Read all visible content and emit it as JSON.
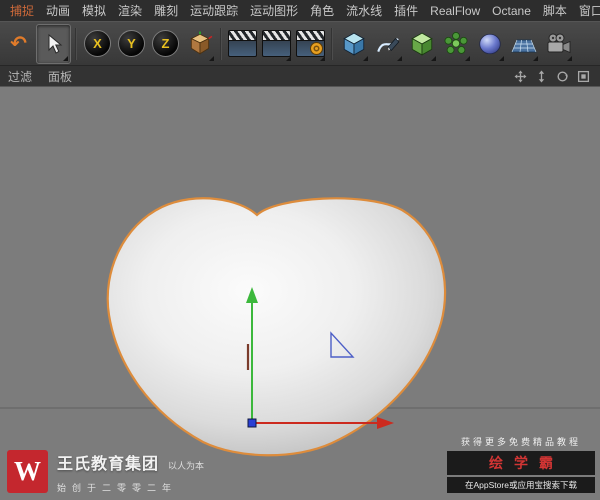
{
  "colors": {
    "menubar_bg": "#2d2d2d",
    "accent_menu": "#cf6a3a",
    "viewport_bg": "#7c7c7c",
    "heart_outline": "#dd8c3c",
    "axis_green": "#3cb83c",
    "axis_red": "#cc2a1e",
    "origin_blue": "#2a3fd4",
    "logo_red": "#c4272e",
    "brand_red": "#d23534",
    "xyz_yellow": "#e8c020"
  },
  "menubar": {
    "items": [
      {
        "label": "捕捉"
      },
      {
        "label": "动画"
      },
      {
        "label": "模拟"
      },
      {
        "label": "渲染"
      },
      {
        "label": "雕刻"
      },
      {
        "label": "运动跟踪"
      },
      {
        "label": "运动图形"
      },
      {
        "label": "角色"
      },
      {
        "label": "流水线"
      },
      {
        "label": "插件"
      },
      {
        "label": "RealFlow"
      },
      {
        "label": "Octane"
      },
      {
        "label": "脚本"
      },
      {
        "label": "窗口"
      }
    ]
  },
  "toolbar": {
    "axis_locks": {
      "x": "X",
      "y": "Y",
      "z": "Z"
    },
    "icons": [
      "undo-icon",
      "live-selection-icon",
      "lock-x-axis-icon",
      "lock-y-axis-icon",
      "lock-z-axis-icon",
      "coordinate-system-icon",
      "render-view-icon",
      "render-picture-viewer-icon",
      "render-settings-icon",
      "add-primitive-cube-icon",
      "spline-pen-icon",
      "subdivision-surface-icon",
      "array-generator-icon",
      "deformer-icon",
      "floor-grid-icon",
      "camera-icon"
    ]
  },
  "viewbar": {
    "filter": "过滤",
    "panel": "面板",
    "nav_icons": [
      "pan-icon",
      "dolly-icon",
      "orbit-icon",
      "maximize-view-icon"
    ]
  },
  "watermark_left": {
    "logo_letter": "W",
    "brand": "王氏教育集团",
    "tagline": "以人为本",
    "subtitle": "始创于二零零二年"
  },
  "watermark_right": {
    "line1": "获得更多免费精品教程",
    "brand": "绘学霸",
    "line2": "在AppStore或应用宝搜索下载"
  }
}
